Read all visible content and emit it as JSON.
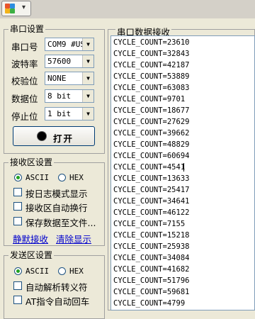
{
  "toolbar": {
    "menu_caret": "▾",
    "logo_icon": "app-logo-icon"
  },
  "port_settings": {
    "title": "串口设置",
    "fields": [
      {
        "label": "串口号",
        "value": "COM9 #US"
      },
      {
        "label": "波特率",
        "value": "57600"
      },
      {
        "label": "校验位",
        "value": "NONE"
      },
      {
        "label": "数据位",
        "value": "8 bit"
      },
      {
        "label": "停止位",
        "value": "1 bit"
      }
    ],
    "open_button_label": "打开"
  },
  "receive_settings": {
    "title": "接收区设置",
    "radio_ascii": "ASCII",
    "radio_hex": "HEX",
    "selected": "ASCII",
    "options": [
      "按日志模式显示",
      "接收区自动换行",
      "保存数据至文件..."
    ],
    "link_pause": "静默接收",
    "link_clear": "清除显示"
  },
  "send_settings": {
    "title": "发送区设置",
    "radio_ascii": "ASCII",
    "radio_hex": "HEX",
    "selected": "ASCII",
    "options": [
      "自动解析转义符",
      "AT指令自动回车"
    ]
  },
  "receive_area": {
    "title": "串口数据接收",
    "lines": [
      "CYCLE_COUNT=23610",
      "CYCLE_COUNT=32843",
      "CYCLE_COUNT=42187",
      "CYCLE_COUNT=53889",
      "CYCLE_COUNT=63083",
      "CYCLE_COUNT=9701",
      "CYCLE_COUNT=18677",
      "CYCLE_COUNT=27629",
      "CYCLE_COUNT=39662",
      "CYCLE_COUNT=48829",
      "CYCLE_COUNT=60694",
      "CYCLE_COUNT=4541",
      "CYCLE_COUNT=13633",
      "CYCLE_COUNT=25417",
      "CYCLE_COUNT=34641",
      "CYCLE_COUNT=46122",
      "CYCLE_COUNT=7155",
      "CYCLE_COUNT=15218",
      "CYCLE_COUNT=25938",
      "CYCLE_COUNT=34084",
      "CYCLE_COUNT=41682",
      "CYCLE_COUNT=51796",
      "CYCLE_COUNT=59681",
      "CYCLE_COUNT=4799"
    ]
  }
}
